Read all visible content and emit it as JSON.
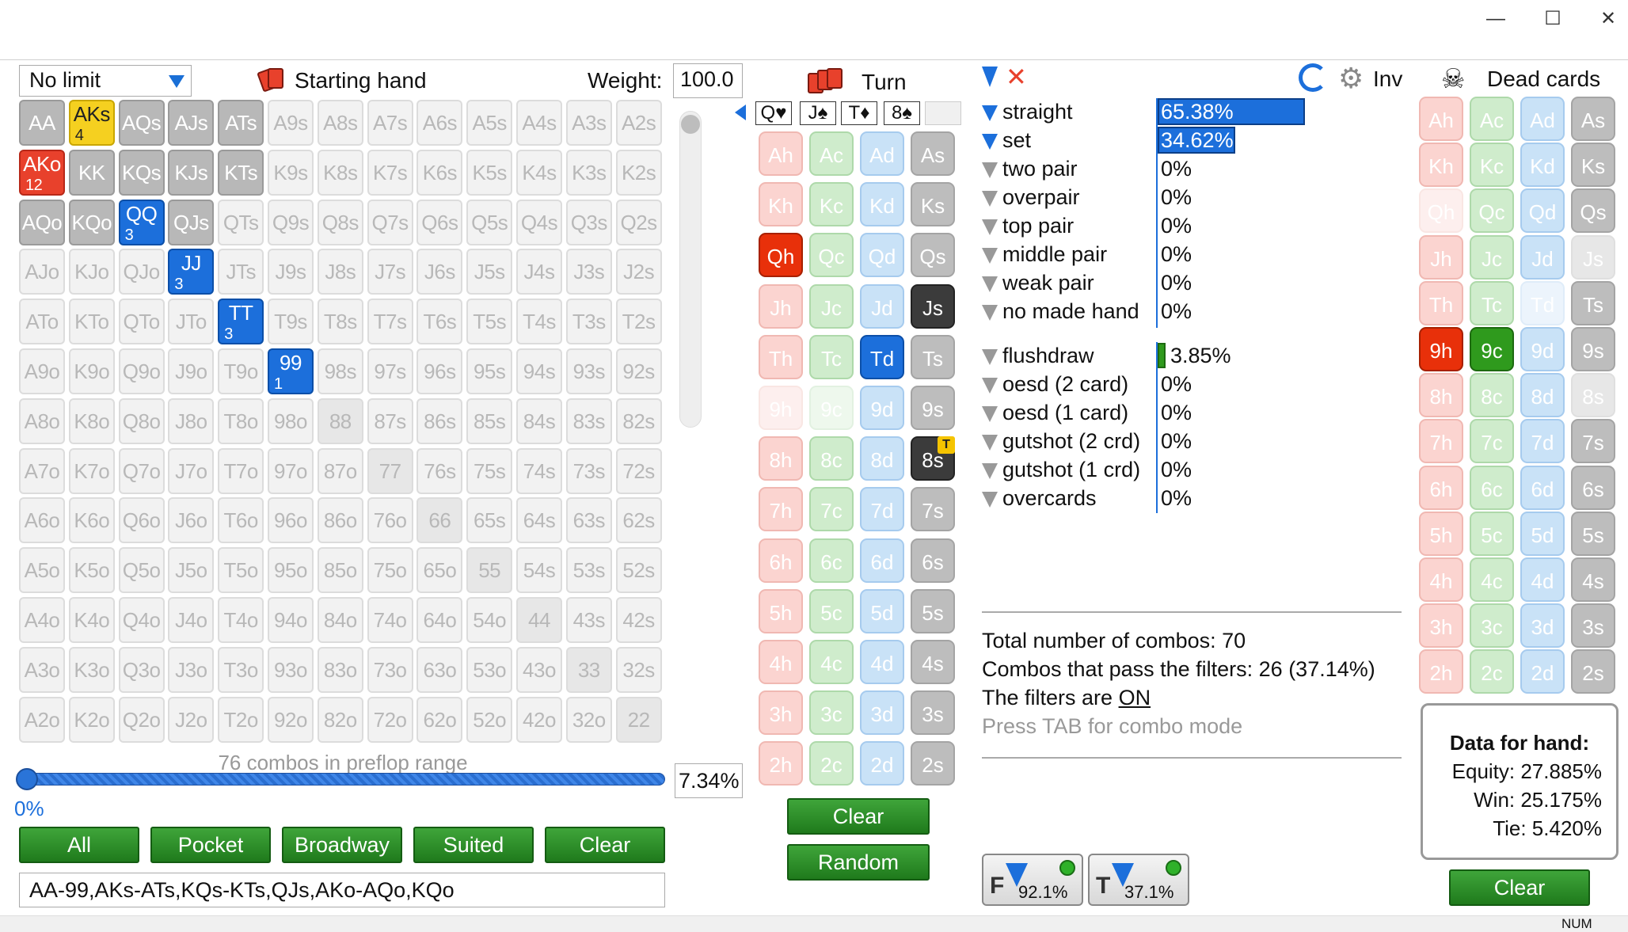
{
  "window": {
    "minimize": "—",
    "maximize": "☐",
    "close": "✕"
  },
  "preflop": {
    "limit": "No limit",
    "starting_hand_label": "Starting hand",
    "weight_label": "Weight:",
    "weight_value": "100.0",
    "combos_text": "76 combos in preflop range",
    "slider_min": "0%",
    "range_percent": "7.34%",
    "range_percent_value": 7.34,
    "range_text": "AA-99,AKs-ATs,KQs-KTs,QJs,AKo-AQo,KQo",
    "buttons": [
      "All",
      "Pocket",
      "Broadway",
      "Suited",
      "Clear"
    ]
  },
  "grid": {
    "ranks": [
      "A",
      "K",
      "Q",
      "J",
      "T",
      "9",
      "8",
      "7",
      "6",
      "5",
      "4",
      "3",
      "2"
    ],
    "special": {
      "AKs": {
        "style": "ak",
        "count": "4"
      },
      "AKo": {
        "style": "red",
        "count": "12"
      },
      "QQ": {
        "style": "blue",
        "count": "3"
      },
      "JJ": {
        "style": "blue",
        "count": "3"
      },
      "TT": {
        "style": "blue",
        "count": "3"
      },
      "99": {
        "style": "blue",
        "count": "1"
      }
    },
    "selected": [
      "AA",
      "AQs",
      "AJs",
      "ATs",
      "KK",
      "KQs",
      "KJs",
      "KTs",
      "QJs",
      "AQo",
      "KQo"
    ]
  },
  "board": {
    "street_label": "Turn",
    "slots": [
      "Q♥",
      "J♠",
      "T♦",
      "8♠",
      ""
    ],
    "cards": [
      [
        "Ah",
        "Ac",
        "Ad",
        "As"
      ],
      [
        "Kh",
        "Kc",
        "Kd",
        "Ks"
      ],
      [
        "Qh",
        "Qc",
        "Qd",
        "Qs"
      ],
      [
        "Jh",
        "Jc",
        "Jd",
        "Js"
      ],
      [
        "Th",
        "Tc",
        "Td",
        "Ts"
      ],
      [
        "9h",
        "9c",
        "9d",
        "9s"
      ],
      [
        "8h",
        "8c",
        "8d",
        "8s"
      ],
      [
        "7h",
        "7c",
        "7d",
        "7s"
      ],
      [
        "6h",
        "6c",
        "6d",
        "6s"
      ],
      [
        "5h",
        "5c",
        "5d",
        "5s"
      ],
      [
        "4h",
        "4c",
        "4d",
        "4s"
      ],
      [
        "3h",
        "3c",
        "3d",
        "3s"
      ],
      [
        "2h",
        "2c",
        "2d",
        "2s"
      ]
    ],
    "selected": [
      "Qh",
      "Js",
      "Td",
      "8s"
    ],
    "dimmed": [
      "9h",
      "9c"
    ],
    "turn_badge": "T",
    "clear_button": "Clear",
    "random_button": "Random"
  },
  "stats": {
    "inv_label": "Inv",
    "made_hands": [
      {
        "name": "straight",
        "value": "65.38%",
        "active": true,
        "fraction": 0.6538
      },
      {
        "name": "set",
        "value": "34.62%",
        "active": true,
        "fraction": 0.3462
      },
      {
        "name": "two pair",
        "value": "0%",
        "active": false
      },
      {
        "name": "overpair",
        "value": "0%",
        "active": false
      },
      {
        "name": "top pair",
        "value": "0%",
        "active": false
      },
      {
        "name": "middle pair",
        "value": "0%",
        "active": false
      },
      {
        "name": "weak pair",
        "value": "0%",
        "active": false
      },
      {
        "name": "no made hand",
        "value": "0%",
        "active": false
      }
    ],
    "draws": [
      {
        "name": "flushdraw",
        "value": "3.85%",
        "fraction": 0.0385
      },
      {
        "name": "oesd (2 card)",
        "value": "0%"
      },
      {
        "name": "oesd (1 card)",
        "value": "0%"
      },
      {
        "name": "gutshot (2 crd)",
        "value": "0%"
      },
      {
        "name": "gutshot (1 crd)",
        "value": "0%"
      },
      {
        "name": "overcards",
        "value": "0%"
      }
    ],
    "total_combos": "Total number of combos: 70",
    "pass_combos": "Combos that pass the filters: 26 (37.14%)",
    "filters_on_prefix": "The filters are ",
    "filters_on_state": "ON",
    "tab_hint": "Press TAB for combo mode",
    "filter_boxes": [
      {
        "letter": "F",
        "pct": "92.1%"
      },
      {
        "letter": "T",
        "pct": "37.1%"
      }
    ]
  },
  "dead": {
    "title": "Dead cards",
    "selected": [
      "9h",
      "9c"
    ],
    "dimmed": [
      "Qh",
      "Td",
      "Js",
      "8s"
    ],
    "data_title": "Data for hand:",
    "equity": "Equity: 27.885%",
    "win": "Win: 25.175%",
    "tie": "Tie: 5.420%",
    "clear_button": "Clear"
  },
  "status": {
    "num": "NUM"
  },
  "colors": {
    "accent": "#1c6fdb",
    "green": "#2e8c28",
    "red": "#e8300a",
    "yellow": "#f5d020"
  }
}
